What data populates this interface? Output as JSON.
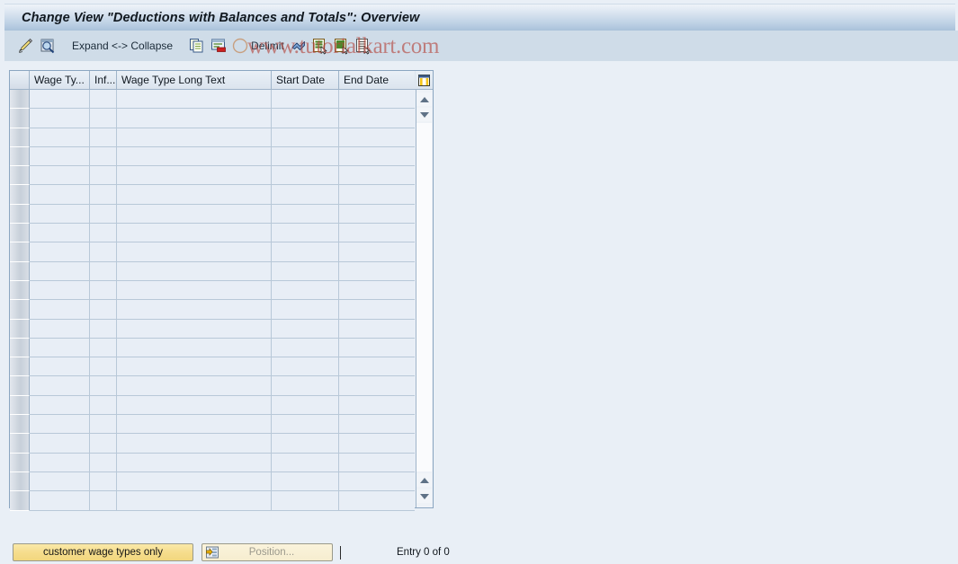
{
  "window": {
    "title": "Change View \"Deductions with Balances and Totals\": Overview"
  },
  "watermark": {
    "text": "www.tutorialkart.com",
    "color": "#b4443b"
  },
  "toolbar": {
    "items": [
      {
        "name": "change-display-icon",
        "label": "",
        "icon": "pencil-magnifier-icon"
      },
      {
        "name": "display-details-icon",
        "label": "",
        "icon": "magnifier-icon"
      },
      {
        "name": "expand-collapse",
        "label": "Expand <-> Collapse",
        "icon": ""
      },
      {
        "name": "copy-as-icon",
        "label": "",
        "icon": "copy-icon"
      },
      {
        "name": "delete-icon",
        "label": "",
        "icon": "delete-row-icon"
      },
      {
        "name": "delimit-button",
        "label": "Delimit",
        "icon": "delimit-circle-icon"
      },
      {
        "name": "undo-icon",
        "label": "",
        "icon": "undo-arrow-icon"
      },
      {
        "name": "select-all-icon",
        "label": "",
        "icon": "select-all-icon"
      },
      {
        "name": "deselect-all-icon",
        "label": "",
        "icon": "deselect-all-icon"
      },
      {
        "name": "select-block-icon",
        "label": "",
        "icon": "select-block-icon"
      }
    ]
  },
  "table": {
    "columns": [
      {
        "key": "select",
        "label": ""
      },
      {
        "key": "wage_type",
        "label": "Wage Ty..."
      },
      {
        "key": "infotype",
        "label": "Inf..."
      },
      {
        "key": "long_text",
        "label": "Wage Type Long Text"
      },
      {
        "key": "start_date",
        "label": "Start Date"
      },
      {
        "key": "end_date",
        "label": "End Date"
      }
    ],
    "rows": [],
    "empty_row_count": 22,
    "config_icon": "table-settings-icon"
  },
  "scrollbar": {
    "up_icon": "triangle-up-icon",
    "down_icon": "triangle-down-icon"
  },
  "footer": {
    "customer_button": "customer wage types only",
    "position_icon": "position-icon",
    "position_placeholder": "Position...",
    "entry_status": "Entry 0 of 0"
  }
}
